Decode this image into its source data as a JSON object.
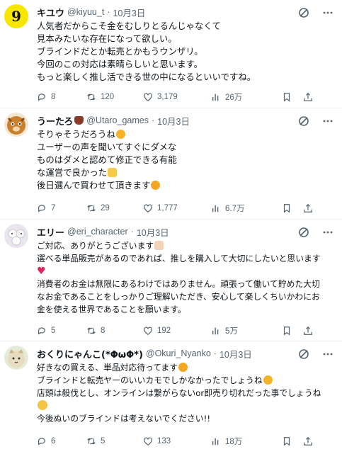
{
  "tweets": [
    {
      "name": "キユウ",
      "handle": "@kiyuu_t",
      "sep": "·",
      "date": "10月3日",
      "lines": [
        "人気者だからこそ金をむしりとるんじゃなくて",
        "見本みたいな存在になって欲しい。",
        "ブラインドだとか転売とかもうウンザリ。",
        "今回のこの対応は素晴らしいと思います。",
        "もっと楽しく推し活できる世の中になるといいですね。"
      ],
      "replies": "8",
      "retweets": "120",
      "likes": "3,179",
      "views": "26万",
      "avatar_text": "9"
    },
    {
      "name": "うーたろ",
      "handle": "@Utaro_games",
      "sep": "·",
      "date": "10月3日",
      "lines": [
        "そりゃそうだろうね",
        "ユーザーの声を聞いてすぐにダメな",
        "ものはダメと認めて修正できる有能",
        "な運営で良かった",
        "後日選んで買わせて頂きます"
      ],
      "replies": "7",
      "retweets": "29",
      "likes": "1,777",
      "views": "6.7万"
    },
    {
      "name": "エリー",
      "handle": "@eri_character",
      "sep": "·",
      "date": "10月3日",
      "lines": [
        "ご対応、ありがとうございます",
        "選べる単品販売があるのであれば、推しを購入して大切にしたいと思います",
        "",
        "消費者のお金は無限にあるわけではありません。頑張って働いて貯めた大切",
        "なお金であることをしっかりご理解いただき、安心して楽しくちいかわにお",
        "金を使える世界であることを願います。"
      ],
      "replies": "5",
      "retweets": "8",
      "likes": "192",
      "views": "5万"
    },
    {
      "name": "おくりにゃんこ(*ΦωΦ*)",
      "handle": "@Okuri_Nyanko",
      "sep": "·",
      "date": "10月3日",
      "lines": [
        "好きなの買える、単品対応待ってます",
        "ブラインドと転売ヤーのいいカモでしかなかったでしょうね",
        "店頭は殺伐とし、オンラインは繋がらないor即売り切れだった事でしょうね",
        "",
        "今後ぬいのブラインドは考えないでください!!"
      ],
      "replies": "6",
      "retweets": "5",
      "likes": "133",
      "views": "18万"
    }
  ],
  "colors": {
    "text": "#0f1419",
    "muted": "#536471",
    "border": "#eff3f4",
    "heart": "#e0245e"
  }
}
